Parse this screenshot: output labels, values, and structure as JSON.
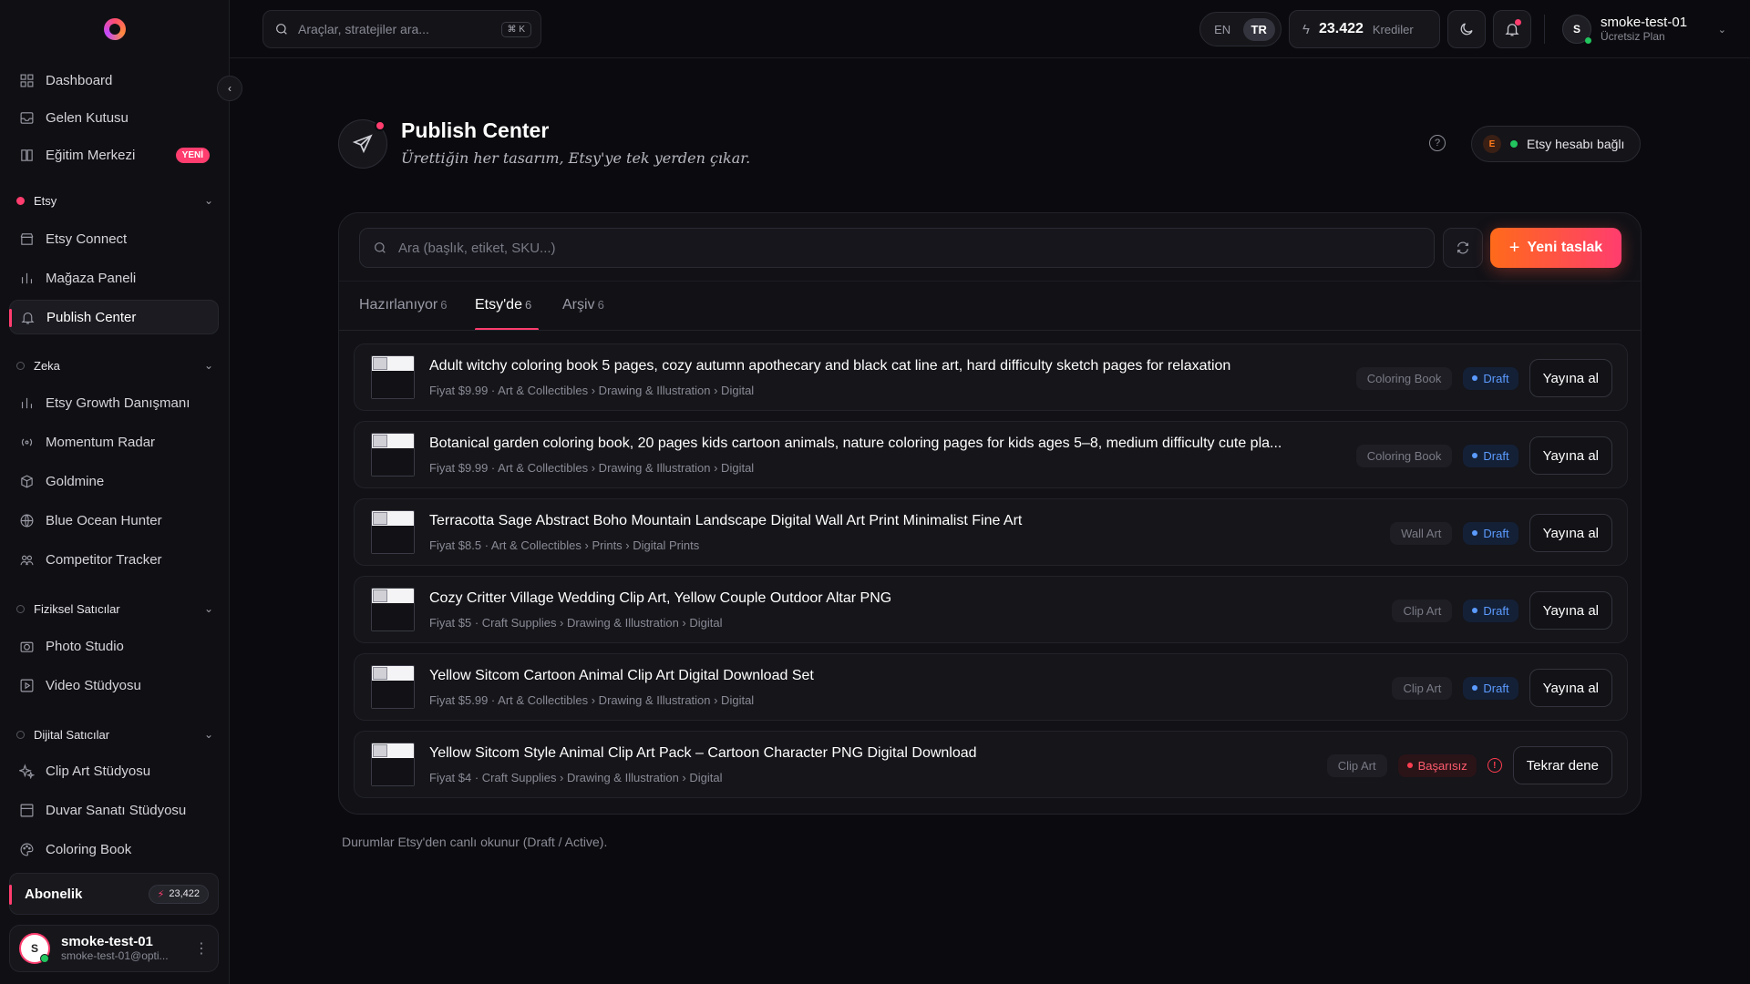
{
  "sidebar": {
    "top_items": [
      {
        "label": "Dashboard",
        "icon": "grid-icon"
      },
      {
        "label": "Gelen Kutusu",
        "icon": "inbox-icon"
      },
      {
        "label": "Eğitim Merkezi",
        "icon": "book-icon",
        "badge": "YENİ"
      }
    ],
    "sections": [
      {
        "title": "Etsy",
        "active": true,
        "items": [
          {
            "label": "Etsy Connect",
            "icon": "store-icon"
          },
          {
            "label": "Mağaza Paneli",
            "icon": "bar-chart-icon"
          },
          {
            "label": "Publish Center",
            "icon": "bell-icon",
            "active": true
          }
        ]
      },
      {
        "title": "Zeka",
        "active": false,
        "items": [
          {
            "label": "Etsy Growth Danışmanı",
            "icon": "bar-chart-icon"
          },
          {
            "label": "Momentum Radar",
            "icon": "radar-icon"
          },
          {
            "label": "Goldmine",
            "icon": "box-icon"
          },
          {
            "label": "Blue Ocean Hunter",
            "icon": "globe-icon"
          },
          {
            "label": "Competitor Tracker",
            "icon": "users-icon"
          }
        ]
      },
      {
        "title": "Fiziksel Satıcılar",
        "active": false,
        "items": [
          {
            "label": "Photo Studio",
            "icon": "camera-icon"
          },
          {
            "label": "Video Stüdyosu",
            "icon": "play-icon"
          }
        ]
      },
      {
        "title": "Dijital Satıcılar",
        "active": false,
        "items": [
          {
            "label": "Clip Art Stüdyosu",
            "icon": "sparkles-icon"
          },
          {
            "label": "Duvar Sanatı Stüdyosu",
            "icon": "frame-icon"
          },
          {
            "label": "Coloring Book",
            "icon": "palette-icon"
          }
        ]
      }
    ],
    "subscription": {
      "label": "Abonelik",
      "credits": "23,422"
    },
    "user": {
      "initial": "S",
      "name": "smoke-test-01",
      "email": "smoke-test-01@opti..."
    }
  },
  "topbar": {
    "search_placeholder": "Araçlar, stratejiler ara...",
    "shortcut": "⌘ K",
    "lang": {
      "options": [
        "EN",
        "TR"
      ],
      "selected": "TR"
    },
    "credits": {
      "value": "23.422",
      "label": "Krediler"
    },
    "user": {
      "initial": "S",
      "name": "smoke-test-01",
      "plan": "Ücretsiz Plan"
    }
  },
  "header": {
    "title": "Publish Center",
    "subtitle": "Ürettiğin her tasarım, Etsy'ye tek yerden çıkar.",
    "etsy_badge": {
      "letter": "E",
      "label": "Etsy hesabı bağlı"
    }
  },
  "panel": {
    "search_placeholder": "Ara (başlık, etiket, SKU...)",
    "new_button": "Yeni taslak",
    "tabs": [
      {
        "label": "Hazırlanıyor",
        "count": "6"
      },
      {
        "label": "Etsy'de",
        "count": "6",
        "active": true
      },
      {
        "label": "Arşiv",
        "count": "6"
      }
    ],
    "rows": [
      {
        "title": "Adult witchy coloring book 5 pages, cozy autumn apothecary and black cat line art, hard difficulty sketch pages for relaxation",
        "meta": "Fiyat $9.99 · Art & Collectibles › Drawing & Illustration › Digital",
        "category": "Coloring Book",
        "status": "Draft",
        "status_kind": "draft",
        "action": "Yayına al"
      },
      {
        "title": "Botanical garden coloring book, 20 pages kids cartoon animals, nature coloring pages for kids ages 5–8, medium difficulty cute pla...",
        "meta": "Fiyat $9.99 · Art & Collectibles › Drawing & Illustration › Digital",
        "category": "Coloring Book",
        "status": "Draft",
        "status_kind": "draft",
        "action": "Yayına al"
      },
      {
        "title": "Terracotta Sage Abstract Boho Mountain Landscape Digital Wall Art Print Minimalist Fine Art",
        "meta": "Fiyat $8.5 · Art & Collectibles › Prints › Digital Prints",
        "category": "Wall Art",
        "status": "Draft",
        "status_kind": "draft",
        "action": "Yayına al"
      },
      {
        "title": "Cozy Critter Village Wedding Clip Art, Yellow Couple Outdoor Altar PNG",
        "meta": "Fiyat $5 · Craft Supplies › Drawing & Illustration › Digital",
        "category": "Clip Art",
        "status": "Draft",
        "status_kind": "draft",
        "action": "Yayına al"
      },
      {
        "title": "Yellow Sitcom Cartoon Animal Clip Art Digital Download Set",
        "meta": "Fiyat $5.99 · Art & Collectibles › Drawing & Illustration › Digital",
        "category": "Clip Art",
        "status": "Draft",
        "status_kind": "draft",
        "action": "Yayına al"
      },
      {
        "title": "Yellow Sitcom Style Animal Clip Art Pack – Cartoon Character PNG Digital Download",
        "meta": "Fiyat $4 · Craft Supplies › Drawing & Illustration › Digital",
        "category": "Clip Art",
        "status": "Başarısız",
        "status_kind": "fail",
        "action": "Tekrar dene"
      }
    ],
    "footnote": "Durumlar Etsy'den canlı okunur (Draft / Active)."
  },
  "colors": {
    "accent": "#ff3d6e",
    "accent_orange": "#ff6a1a",
    "draft": "#5b9bff",
    "fail": "#ff3d50",
    "online": "#22c55e"
  }
}
